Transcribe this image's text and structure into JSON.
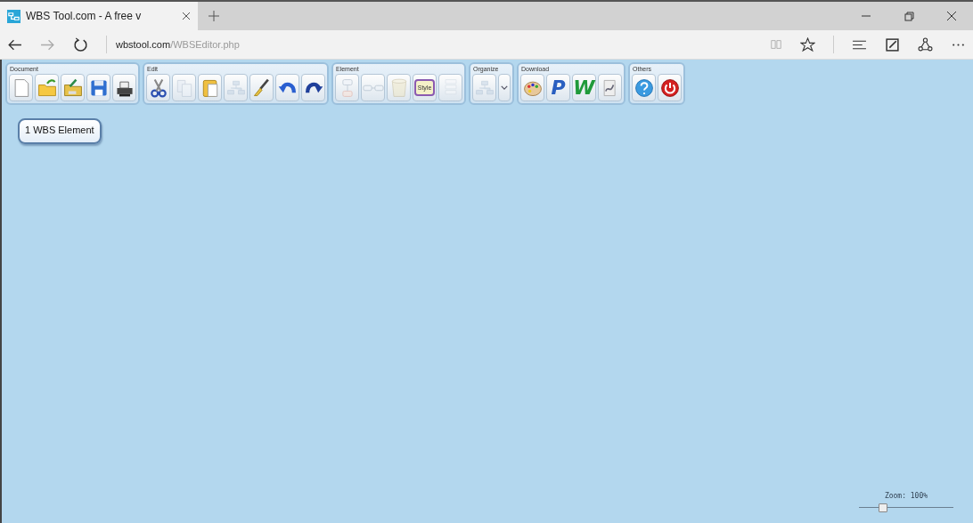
{
  "browser": {
    "tab_title": "WBS Tool.com - A free v",
    "address_host": "wbstool.com",
    "address_path": "/WBSEditor.php",
    "forward_disabled": true
  },
  "toolbar": [
    {
      "title": "Document",
      "buttons": [
        {
          "kind": "new",
          "disabled": false
        },
        {
          "kind": "open",
          "disabled": false
        },
        {
          "kind": "open-xml",
          "disabled": false
        },
        {
          "kind": "save",
          "disabled": false
        },
        {
          "kind": "print",
          "disabled": false
        }
      ]
    },
    {
      "title": "Edit",
      "buttons": [
        {
          "kind": "cut",
          "disabled": false
        },
        {
          "kind": "copy",
          "disabled": true
        },
        {
          "kind": "paste",
          "disabled": false
        },
        {
          "kind": "layout",
          "disabled": true
        },
        {
          "kind": "brush",
          "disabled": false
        },
        {
          "kind": "undo",
          "disabled": false
        },
        {
          "kind": "redo",
          "disabled": false
        }
      ]
    },
    {
      "title": "Element",
      "buttons": [
        {
          "kind": "add-child",
          "disabled": true
        },
        {
          "kind": "add-sibling",
          "disabled": true
        },
        {
          "kind": "delete",
          "disabled": true
        },
        {
          "kind": "style",
          "label": "Style",
          "disabled": false
        },
        {
          "kind": "list",
          "disabled": true
        }
      ]
    },
    {
      "title": "Organize",
      "buttons": [
        {
          "kind": "layout",
          "disabled": true
        },
        {
          "kind": "dropdown",
          "disabled": false
        }
      ]
    },
    {
      "title": "Download",
      "buttons": [
        {
          "kind": "palette",
          "disabled": false
        },
        {
          "kind": "letter",
          "label": "P",
          "color": "#2a5fc0",
          "disabled": false
        },
        {
          "kind": "letter",
          "label": "W",
          "color": "#1f9a3a",
          "disabled": false
        },
        {
          "kind": "image",
          "disabled": false
        }
      ]
    },
    {
      "title": "Others",
      "buttons": [
        {
          "kind": "help",
          "disabled": false
        },
        {
          "kind": "power",
          "disabled": false
        }
      ]
    }
  ],
  "canvas": {
    "elements": [
      {
        "label": "1 WBS Element"
      }
    ]
  },
  "zoom": {
    "label": "Zoom: 100%",
    "level": 0.25
  }
}
